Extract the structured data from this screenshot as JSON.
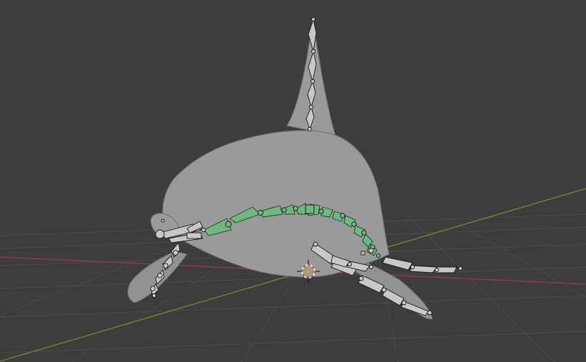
{
  "viewport": {
    "background_color": "#3d3d3d",
    "grid_color": "#4a4a4a",
    "x_axis_color": "#9a3c47",
    "y_axis_color": "#6f8f2c"
  },
  "scene": {
    "mesh_color": "#9a9a9a",
    "mesh_outline_color": "#6e6e6e",
    "bone_color": "#c8c8c8",
    "bone_outline_color": "#141414",
    "selected_bone_color": "#6fb87f",
    "selected_bone_outline_color": "#1f3d25",
    "cursor_colors": [
      "#e0462f",
      "#f2f2f2"
    ]
  }
}
